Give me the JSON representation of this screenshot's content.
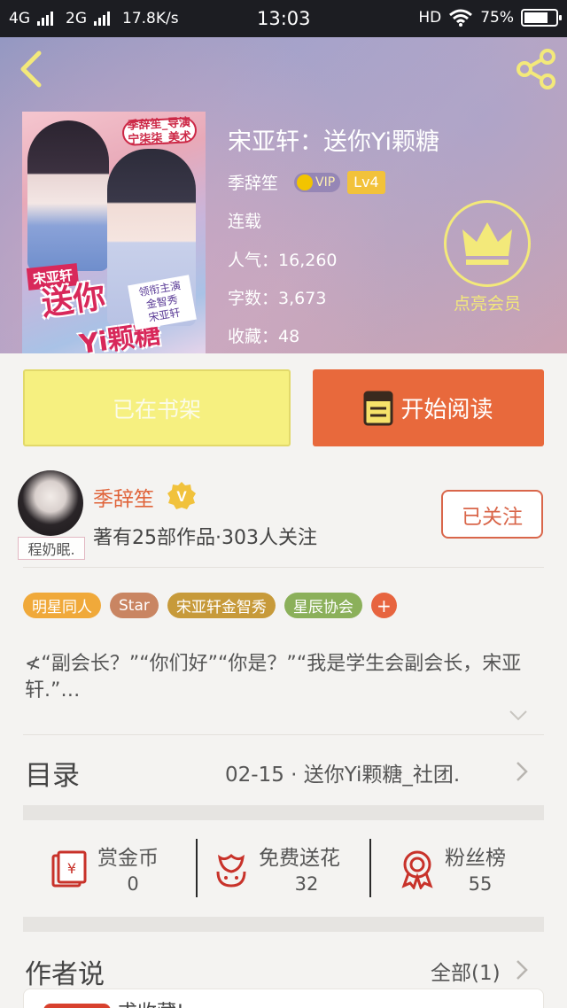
{
  "status_bar": {
    "network1": "4G",
    "network2": "2G",
    "speed": "17.8K/s",
    "time": "13:03",
    "hd": "HD",
    "battery": "75%",
    "battery_level": 0.75
  },
  "book": {
    "title": "宋亚轩：送你Yi颗糖",
    "author": "季辞笙",
    "vip": "VIP",
    "level": "Lv4",
    "status": "连载",
    "popularity_label": "人气：",
    "popularity": "16,260",
    "words_label": "字数：",
    "words": "3,673",
    "favorites_label": "收藏：",
    "favorites": "48",
    "member_label": "点亮会员",
    "cover": {
      "tag": "季辞笙_导演\n宁柒柒_美术",
      "name_tag": "宋亚轩",
      "title_a": "送你",
      "title_b": "Yi颗糖",
      "credits": "领衔主演\n金智秀\n宋亚轩"
    }
  },
  "actions": {
    "shelf": "已在书架",
    "read": "开始阅读"
  },
  "author": {
    "name": "季辞笙",
    "badge": "V",
    "avatar_tag": "程奶眠.",
    "stats": "著有25部作品·303人关注",
    "follow": "已关注"
  },
  "tags": [
    {
      "label": "明星同人",
      "color": "#f0a93a"
    },
    {
      "label": "Star",
      "color": "#c98562"
    },
    {
      "label": "宋亚轩金智秀",
      "color": "#c79a3a"
    },
    {
      "label": "星辰协会",
      "color": "#8bb05a"
    }
  ],
  "tag_plus": "+",
  "description": "≮“副会长？”“你们好”“你是？”“我是学生会副会长，宋亚轩.”…",
  "toc": {
    "label": "目录",
    "latest": "02-15 · 送你Yi颗糖_社团."
  },
  "stats": [
    {
      "label": "赏金币",
      "value": "0",
      "icon": "red-envelope-icon"
    },
    {
      "label": "免费送花",
      "value": "32",
      "icon": "flower-icon"
    },
    {
      "label": "粉丝榜",
      "value": "55",
      "icon": "medal-icon"
    }
  ],
  "author_says": {
    "label": "作者说",
    "all": "全部(1)",
    "preview": "求收藏!"
  },
  "colors": {
    "accent": "#e8693c",
    "shelf": "#f6f080",
    "member": "#f3e97a"
  }
}
